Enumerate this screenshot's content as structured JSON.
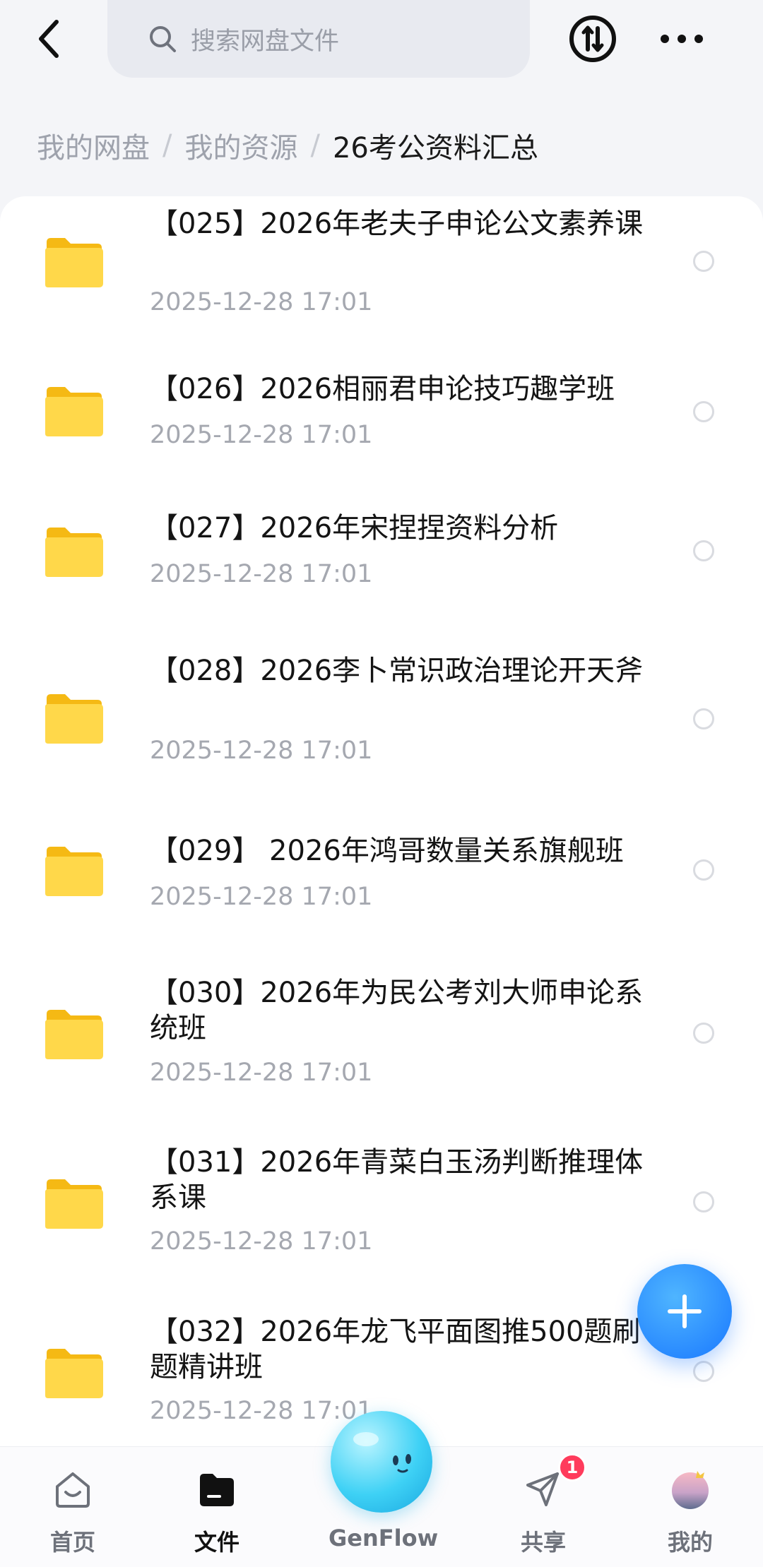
{
  "search": {
    "placeholder": "搜索网盘文件"
  },
  "breadcrumb": [
    "我的网盘",
    "我的资源",
    "26考公资料汇总"
  ],
  "files": [
    {
      "name": "【025】2026年老夫子申论公文素养课",
      "date": "2025-12-28  17:01"
    },
    {
      "name": "【026】2026相丽君申论技巧趣学班",
      "date": "2025-12-28  17:01"
    },
    {
      "name": "【027】2026年宋捏捏资料分析",
      "date": "2025-12-28  17:01"
    },
    {
      "name": "【028】2026李卜常识政治理论开天斧",
      "date": "2025-12-28  17:01"
    },
    {
      "name": "【029】 2026年鸿哥数量关系旗舰班",
      "date": "2025-12-28  17:01"
    },
    {
      "name": "【030】2026年为民公考刘大师申论系统班",
      "date": "2025-12-28  17:01"
    },
    {
      "name": "【031】2026年青菜白玉汤判断推理体系课",
      "date": "2025-12-28  17:01"
    },
    {
      "name": "【032】2026年龙飞平面图推500题刷题精讲班",
      "date": "2025-12-28  17:01"
    }
  ],
  "nav": {
    "home": "首页",
    "files": "文件",
    "genflow": "GenFlow",
    "share": "共享",
    "mine": "我的",
    "share_badge": "1"
  },
  "colors": {
    "accent": "#1978ff",
    "folder": "#ffd23f",
    "badge": "#ff3b5c"
  }
}
